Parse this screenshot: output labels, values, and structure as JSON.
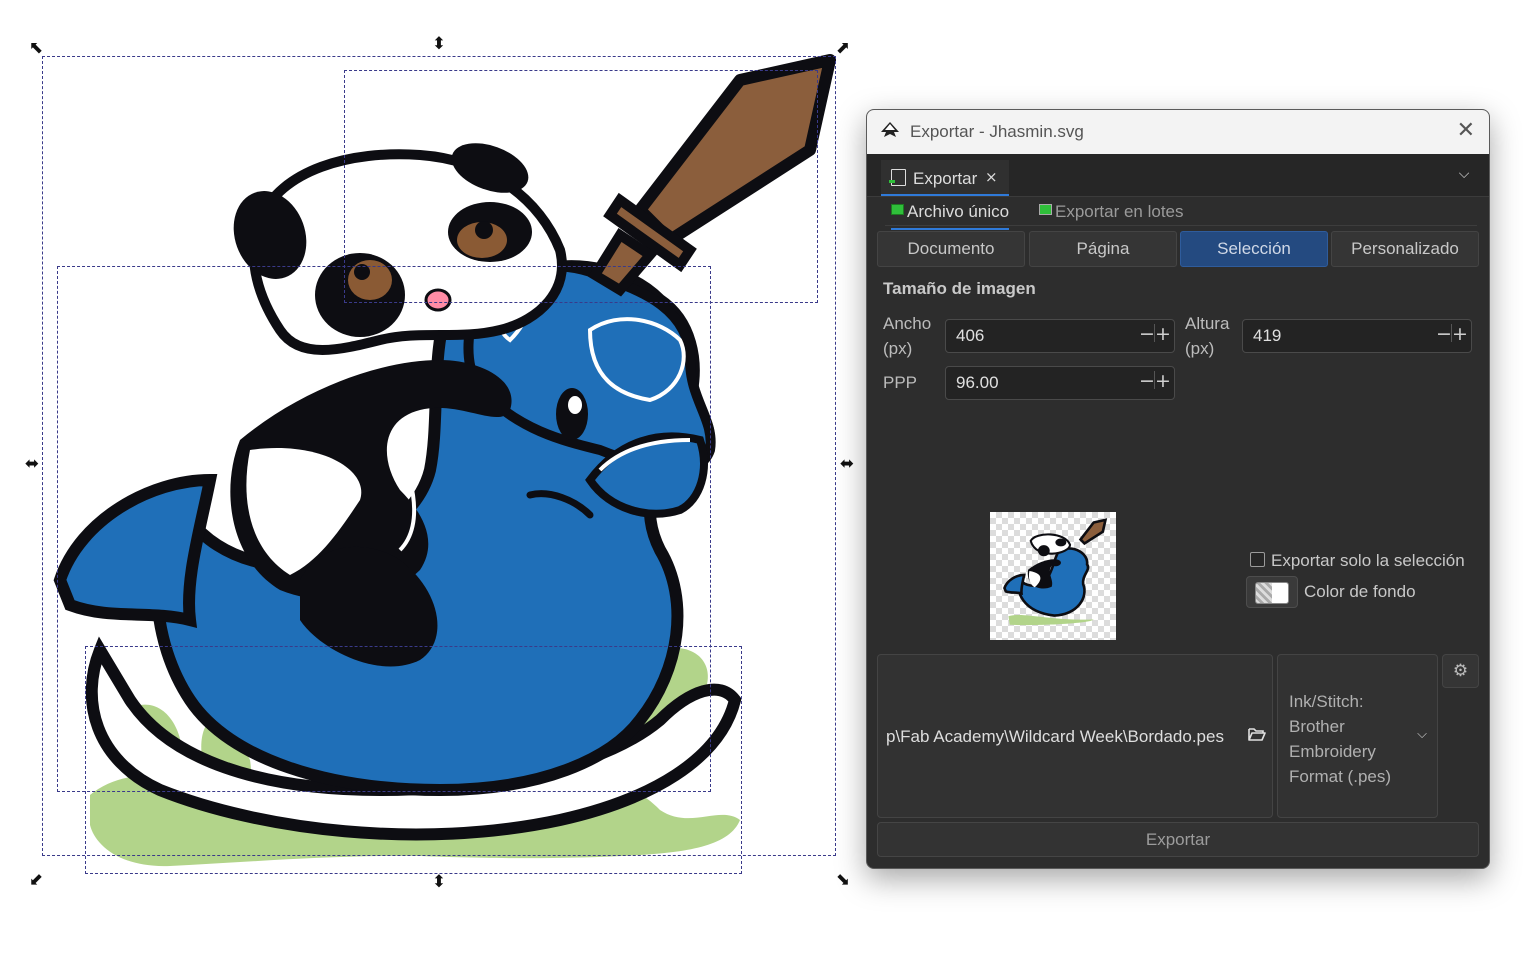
{
  "window": {
    "title": "Exportar - Jhasmin.svg"
  },
  "dock_tab": {
    "label": "Exportar",
    "close": "×"
  },
  "subtabs": {
    "single": "Archivo único",
    "batch": "Exportar en lotes"
  },
  "export_area": {
    "options": [
      "Documento",
      "Página",
      "Selección",
      "Personalizado"
    ],
    "selected": "Selección"
  },
  "image_size": {
    "title": "Tamaño de imagen",
    "width_label": "Ancho",
    "width_unit": "(px)",
    "width_value": "406",
    "height_label": "Altura",
    "height_unit": "(px)",
    "height_value": "419",
    "dpi_label": "PPP",
    "dpi_value": "96.00",
    "minus": "−",
    "plus": "+"
  },
  "options": {
    "only_selection_label": "Exportar solo la selección",
    "only_selection_checked": false,
    "background_label": "Color de fondo"
  },
  "file": {
    "path": "p\\Fab Academy\\Wildcard Week\\Bordado.pes",
    "format_line1": "Ink/Stitch:",
    "format_line2": "Brother",
    "format_line3": "Embroidery",
    "format_line4": "Format (.pes)"
  },
  "export_button": "Exportar",
  "icons": {
    "app": "inkscape-icon",
    "close": "close-icon",
    "menu": "chevron-down-icon",
    "folder": "folder-open-icon",
    "settings": "gear-icon"
  },
  "colors": {
    "selected_area": "#244a80",
    "accent": "#2f7ad9",
    "horse_blue": "#1f6fb8",
    "sword_brown": "#8b5e3c",
    "grass_green": "#b2d48a"
  }
}
